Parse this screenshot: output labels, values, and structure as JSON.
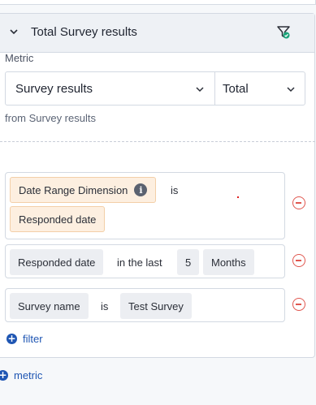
{
  "panel": {
    "title": "Total Survey results",
    "toggle_icon": "chevron-down-icon",
    "filter_icon": "filter-check-icon",
    "colors": {
      "accent": "#1f56b3",
      "remove": "#e0574f",
      "chip_orange": "#fdefe0"
    }
  },
  "metric": {
    "label": "Metric",
    "select_value": "Survey results",
    "aggregation_value": "Total",
    "from_text": "from Survey results"
  },
  "filters": [
    {
      "dimension": "Date Range Dimension",
      "operator": "is",
      "value": "Responded date"
    },
    {
      "dimension": "Responded date",
      "operator": "in the last",
      "amount": "5",
      "unit": "Months"
    },
    {
      "dimension": "Survey name",
      "operator": "is",
      "value": "Test Survey"
    }
  ],
  "actions": {
    "add_filter": "filter",
    "add_metric": "metric"
  }
}
